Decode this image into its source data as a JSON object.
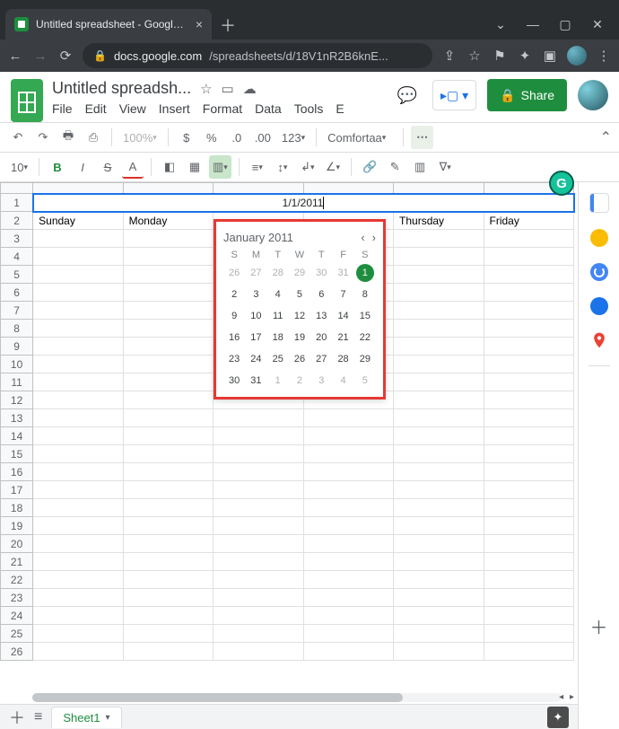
{
  "browser": {
    "tab_title": "Untitled spreadsheet - Google Sh",
    "url_host": "docs.google.com",
    "url_path": "/spreadsheets/d/18V1nR2B6knE..."
  },
  "doc": {
    "title": "Untitled spreadsh...",
    "menus": [
      "File",
      "Edit",
      "View",
      "Insert",
      "Format",
      "Data",
      "Tools",
      "E"
    ],
    "share_label": "Share"
  },
  "toolbar": {
    "zoom": "100%",
    "currency": "$",
    "percent": "%",
    "dec_dec": ".0",
    "inc_dec": ".00",
    "numfmt": "123",
    "font": "Comfortaa",
    "fontsize": "10",
    "bold": "B",
    "italic": "I",
    "strike": "S",
    "color": "A"
  },
  "grid": {
    "active_value": "1/1/2011",
    "rows": 26,
    "col_headers": [
      "",
      " ",
      "  ",
      "   ",
      "    ",
      "     "
    ],
    "day_row": [
      "Sunday",
      "Monday",
      "",
      "",
      "Thursday",
      "Friday"
    ]
  },
  "datepicker": {
    "month_label": "January 2011",
    "dow": [
      "S",
      "M",
      "T",
      "W",
      "T",
      "F",
      "S"
    ],
    "cells": [
      {
        "n": "26",
        "m": true
      },
      {
        "n": "27",
        "m": true
      },
      {
        "n": "28",
        "m": true
      },
      {
        "n": "29",
        "m": true
      },
      {
        "n": "30",
        "m": true
      },
      {
        "n": "31",
        "m": true
      },
      {
        "n": "1",
        "sel": true
      },
      {
        "n": "2"
      },
      {
        "n": "3"
      },
      {
        "n": "4"
      },
      {
        "n": "5"
      },
      {
        "n": "6"
      },
      {
        "n": "7"
      },
      {
        "n": "8"
      },
      {
        "n": "9"
      },
      {
        "n": "10"
      },
      {
        "n": "11"
      },
      {
        "n": "12"
      },
      {
        "n": "13"
      },
      {
        "n": "14"
      },
      {
        "n": "15"
      },
      {
        "n": "16"
      },
      {
        "n": "17"
      },
      {
        "n": "18"
      },
      {
        "n": "19"
      },
      {
        "n": "20"
      },
      {
        "n": "21"
      },
      {
        "n": "22"
      },
      {
        "n": "23"
      },
      {
        "n": "24"
      },
      {
        "n": "25"
      },
      {
        "n": "26"
      },
      {
        "n": "27"
      },
      {
        "n": "28"
      },
      {
        "n": "29"
      },
      {
        "n": "30"
      },
      {
        "n": "31"
      },
      {
        "n": "1",
        "m": true
      },
      {
        "n": "2",
        "m": true
      },
      {
        "n": "3",
        "m": true
      },
      {
        "n": "4",
        "m": true
      },
      {
        "n": "5",
        "m": true
      }
    ]
  },
  "sheettabs": {
    "active": "Sheet1"
  },
  "rail": [
    "calendar",
    "keep",
    "tasks",
    "contacts",
    "maps"
  ]
}
